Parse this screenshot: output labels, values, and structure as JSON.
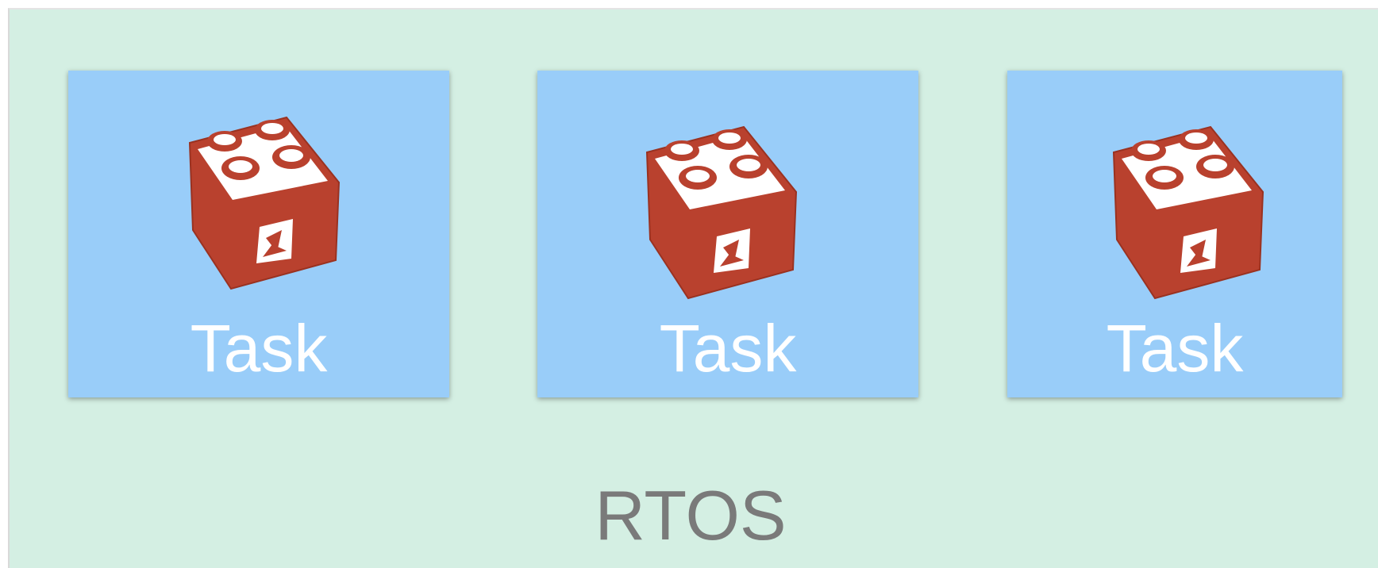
{
  "diagram": {
    "container": {
      "label": "RTOS",
      "color": "#d4efe3"
    },
    "tasks": [
      {
        "label": "Task",
        "icon": "lego-brick-icon"
      },
      {
        "label": "Task",
        "icon": "lego-brick-icon"
      },
      {
        "label": "Task",
        "icon": "lego-brick-icon"
      }
    ],
    "colors": {
      "task_background": "#99cdf9",
      "icon_brick": "#b9412e",
      "task_text": "#ffffff",
      "container_text": "#7a7a7a"
    }
  }
}
